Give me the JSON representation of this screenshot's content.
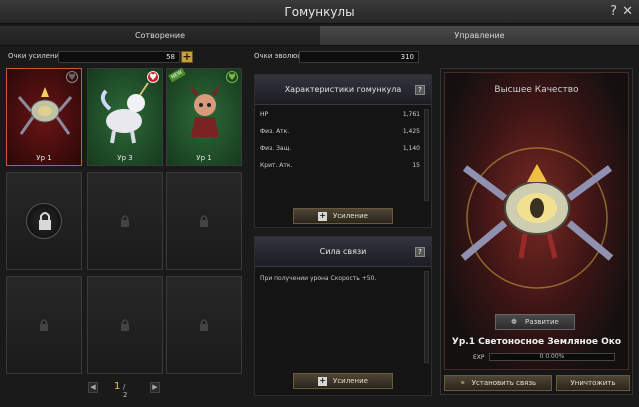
{
  "window": {
    "title": "Гомункулы"
  },
  "tabs": [
    {
      "label": "Сотворение"
    },
    {
      "label": "Управление"
    }
  ],
  "points": {
    "upgrade_label": "Очки усиления",
    "upgrade_value": "58",
    "evolution_label": "Очки эволюции",
    "evolution_value": "310"
  },
  "slots": [
    {
      "level": "Ур 1"
    },
    {
      "level": "Ур 3",
      "new_tag": "NEW"
    },
    {
      "level": "Ур 1",
      "new_tag": "NEW"
    }
  ],
  "pager": {
    "current": "1",
    "total": "/ 2"
  },
  "stats_panel": {
    "title": "Характеристики гомункула",
    "rows": [
      {
        "label": "HP",
        "value": "1,761"
      },
      {
        "label": "Физ. Атк.",
        "value": "1,425"
      },
      {
        "label": "Физ. Защ.",
        "value": "1,140"
      },
      {
        "label": "Крит. Атк.",
        "value": "15"
      }
    ],
    "upgrade_button": "Усиление"
  },
  "bond_panel": {
    "title": "Сила связи",
    "description": "При получении урона Скорость +50.",
    "upgrade_button": "Усиление"
  },
  "preview": {
    "quality": "Высшее Качество",
    "evolve_button": "Развитие",
    "name": "Ур.1 Светоносное Земляное Око",
    "exp_label": "EXP",
    "exp_text": "0 0.00%",
    "exp_fraction": 0
  },
  "bottom_buttons": {
    "bind": "Установить связь",
    "destroy": "Уничтожить"
  },
  "colors": {
    "accent_gold": "#c9a040",
    "selected_border": "#c85a3a",
    "heart_red": "#c71c1c"
  }
}
